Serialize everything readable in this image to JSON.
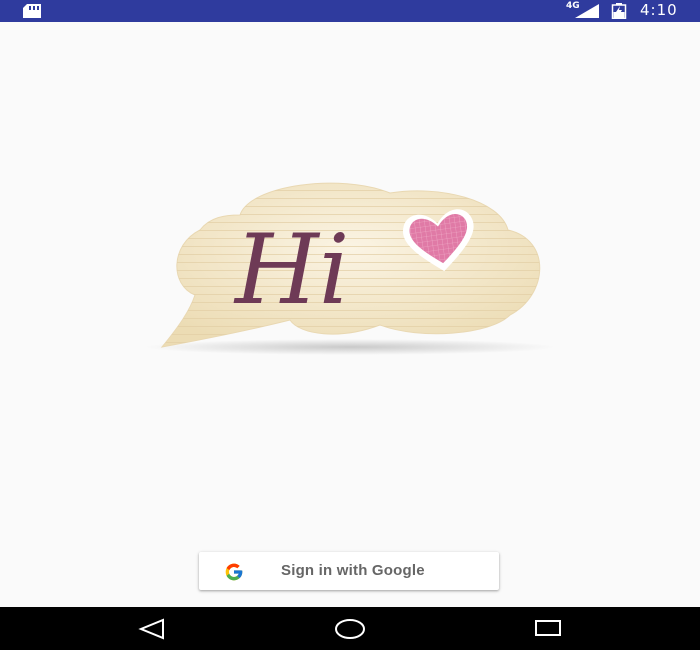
{
  "status_bar": {
    "network_label": "4G",
    "time": "4:10",
    "background": "#2f3b9e",
    "icons": [
      "sd-card-icon",
      "signal-icon",
      "battery-icon"
    ]
  },
  "logo": {
    "text": "Hi",
    "icon": "speech-bubble-heart-logo",
    "bubble_color": "#f3e6c8",
    "text_color": "#6e3a56",
    "heart_color": "#e07aa6"
  },
  "signin": {
    "label": "Sign in with Google",
    "icon": "google-g-icon"
  },
  "nav_bar": {
    "background": "#000000",
    "items": [
      "back-icon",
      "home-icon",
      "recent-apps-icon"
    ]
  }
}
